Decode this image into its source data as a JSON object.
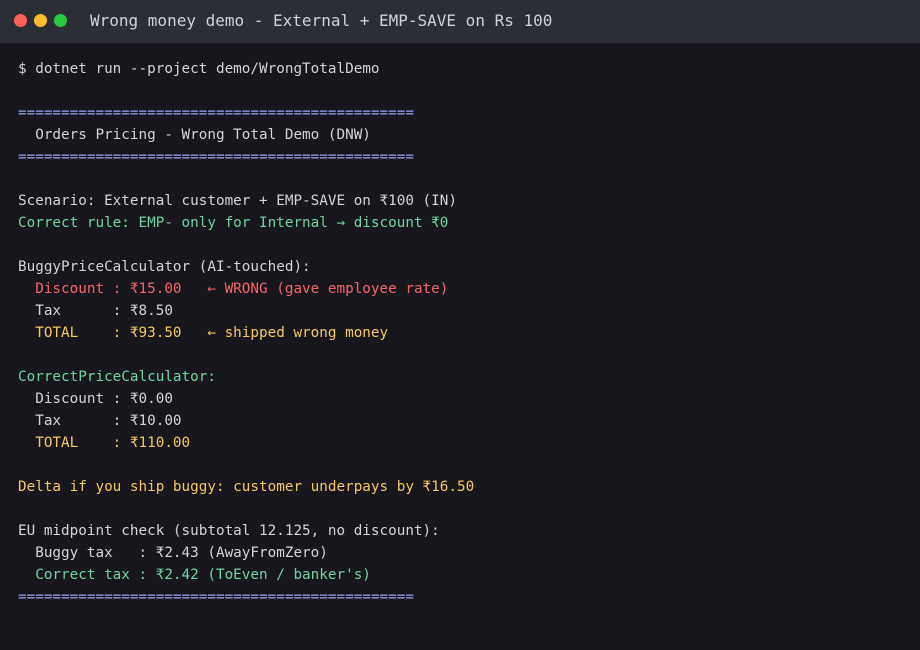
{
  "window": {
    "title": "Wrong money demo - External + EMP-SAVE on Rs 100"
  },
  "terminal": {
    "lines": [
      {
        "text": "$ dotnet run --project demo/WrongTotalDemo",
        "color": "normal"
      },
      {
        "text": "",
        "color": "normal"
      },
      {
        "text": "==============================================",
        "color": "sep"
      },
      {
        "text": "  Orders Pricing - Wrong Total Demo (DNW)",
        "color": "normal"
      },
      {
        "text": "==============================================",
        "color": "sep"
      },
      {
        "text": "",
        "color": "normal"
      },
      {
        "text": "Scenario: External customer + EMP-SAVE on ₹100 (IN)",
        "color": "normal"
      },
      {
        "text": "Correct rule: EMP- only for Internal → discount ₹0",
        "color": "green"
      },
      {
        "text": "",
        "color": "normal"
      },
      {
        "text": "BuggyPriceCalculator (AI-touched):",
        "color": "normal"
      },
      {
        "text": "  Discount : ₹15.00   ← WRONG (gave employee rate)",
        "color": "red"
      },
      {
        "text": "  Tax      : ₹8.50",
        "color": "normal"
      },
      {
        "text": "  TOTAL    : ₹93.50   ← shipped wrong money",
        "color": "yellow"
      },
      {
        "text": "",
        "color": "normal"
      },
      {
        "text": "CorrectPriceCalculator:",
        "color": "green"
      },
      {
        "text": "  Discount : ₹0.00",
        "color": "normal"
      },
      {
        "text": "  Tax      : ₹10.00",
        "color": "normal"
      },
      {
        "text": "  TOTAL    : ₹110.00",
        "color": "yellow"
      },
      {
        "text": "",
        "color": "normal"
      },
      {
        "text": "Delta if you ship buggy: customer underpays by ₹16.50",
        "color": "yellow"
      },
      {
        "text": "",
        "color": "normal"
      },
      {
        "text": "EU midpoint check (subtotal 12.125, no discount):",
        "color": "normal"
      },
      {
        "text": "  Buggy tax   : ₹2.43 (AwayFromZero)",
        "color": "normal"
      },
      {
        "text": "  Correct tax : ₹2.42 (ToEven / banker's)",
        "color": "green"
      },
      {
        "text": "==============================================",
        "color": "sep"
      }
    ]
  },
  "colors": {
    "background": "#17161c",
    "titlebar": "#2b2e35",
    "normal": "#d2d4d9",
    "separator": "#9ba4f0",
    "green": "#6fd3a0",
    "red": "#f2666a",
    "yellow": "#f5c961"
  }
}
